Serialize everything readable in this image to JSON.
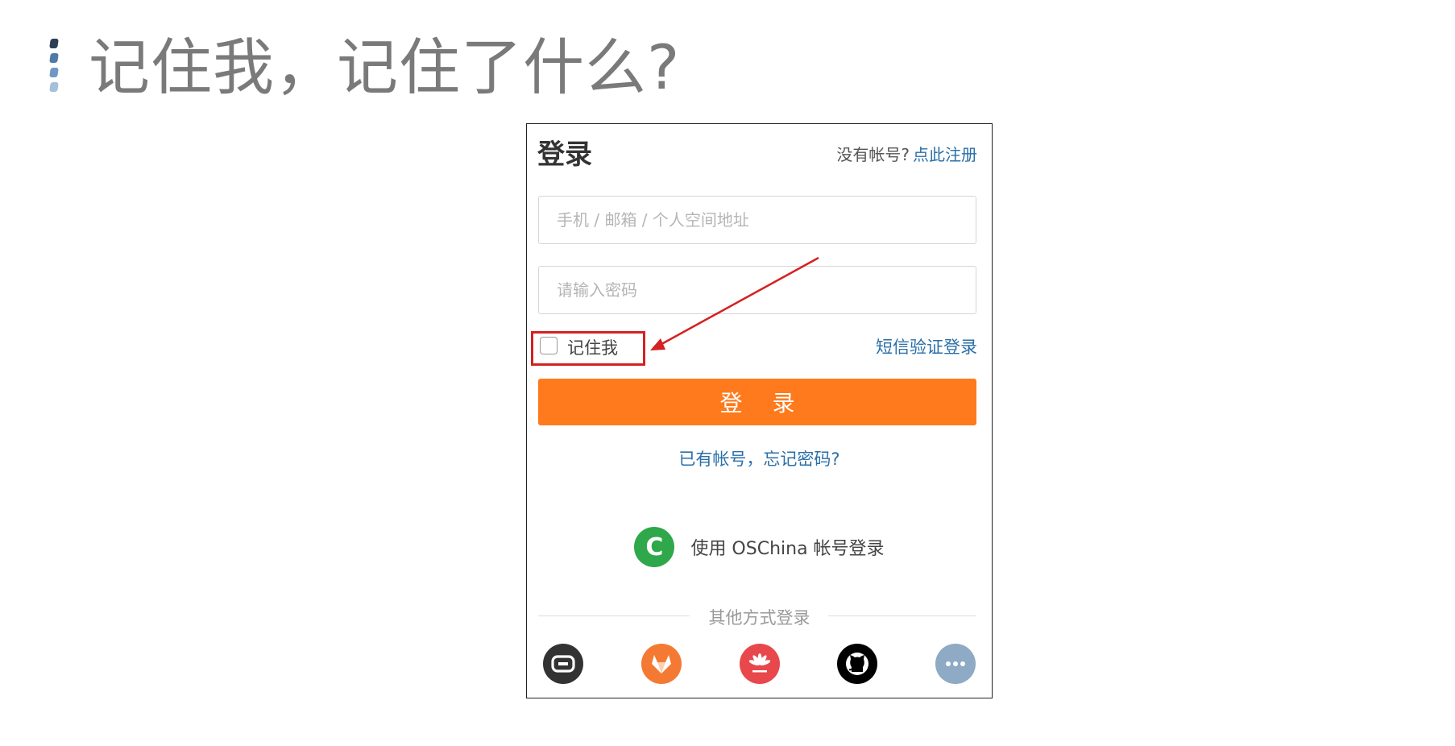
{
  "slide": {
    "title": "记住我，记住了什么?"
  },
  "login": {
    "title": "登录",
    "no_account_text": "没有帐号?",
    "register_link": "点此注册",
    "username_placeholder": "手机 / 邮箱 / 个人空间地址",
    "password_placeholder": "请输入密码",
    "remember_label": "记住我",
    "sms_login": "短信验证登录",
    "login_button": "登 录",
    "forgot_link": "已有帐号，忘记密码?",
    "oschina_login": "使用 OSChina 帐号登录",
    "oschina_icon_letter": "C",
    "other_methods": "其他方式登录",
    "social_icons": [
      {
        "name": "gitee-icon",
        "color": "#333333"
      },
      {
        "name": "gitlab-icon",
        "color": "#f47a33"
      },
      {
        "name": "huawei-icon",
        "color": "#e8474c"
      },
      {
        "name": "github-icon",
        "color": "#000000"
      },
      {
        "name": "more-icon",
        "color": "#8eaac4"
      }
    ]
  },
  "colors": {
    "accent_orange": "#ff7a1c",
    "link_blue": "#2a6fa8",
    "highlight_red": "#d42121",
    "oschina_green": "#2ea84a"
  }
}
